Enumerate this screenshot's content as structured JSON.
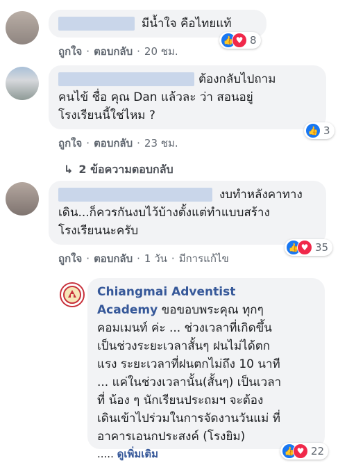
{
  "comments": [
    {
      "text_lines": [
        "มีน้ำใจ คือไทยแท้"
      ],
      "actions": {
        "like": "ถูกใจ",
        "reply": "ตอบกลับ",
        "time": "20 ชม."
      },
      "reaction_count": "8",
      "reaction_icons": [
        "like-icon",
        "love-icon"
      ]
    },
    {
      "text_lines": [
        "ต้องกลับไปถาม",
        "คนไข้ ชื่อ คุณ Dan แล้วละ ว่า สอนอยู่",
        "โรงเรียนนี้ใช่ไหม ?"
      ],
      "actions": {
        "like": "ถูกใจ",
        "reply": "ตอบกลับ",
        "time": "23 ชม."
      },
      "reaction_count": "3",
      "reaction_icons": [
        "like-icon"
      ],
      "replies_label": "2 ข้อความตอบกลับ"
    },
    {
      "text_lines": [
        "งบทำหลังคาทาง",
        "เดิน...ก็ควรกันงบไว้บ้างตั้งแต่ทำแบบสร้าง",
        "โรงเรียนนะครับ"
      ],
      "actions": {
        "like": "ถูกใจ",
        "reply": "ตอบกลับ",
        "time": "1 วัน",
        "edited": "มีการแก้ไข"
      },
      "reaction_count": "35",
      "reaction_icons": [
        "like-icon",
        "love-icon"
      ]
    }
  ],
  "reply": {
    "page_name_line1": "Chiangmai Adventist",
    "page_name_line2": "Academy",
    "text_first": "ขอขอบพระคุณ ทุกๆ",
    "text_lines": [
      "คอมเมนท์ ค่ะ ... ช่วงเวลาที่เกิดขึ้น",
      "เป็นช่วงระยะเวลาสั้นๆ ฝนไม่ได้ตก",
      "แรง ระยะเวลาที่ฝนตกไม่ถึง 10 นาที",
      "... แค่ในช่วงเวลานั้น(สั้นๆ) เป็นเวลา",
      "ที่ น้อง ๆ นักเรียนประถมฯ จะต้อง",
      "เดินเข้าไปร่วมในการจัดงานวันแม่ ที่",
      "อาคารเอนกประสงค์ (โรงยิม)"
    ],
    "ellipsis": ".....",
    "see_more": "ดูเพิ่มเติม",
    "reaction_count": "22",
    "reaction_icons": [
      "like-icon",
      "love-icon"
    ]
  },
  "colors": {
    "link": "#365899",
    "bubble": "#f2f3f5",
    "like": "#1877f2",
    "love": "#f0284a"
  }
}
